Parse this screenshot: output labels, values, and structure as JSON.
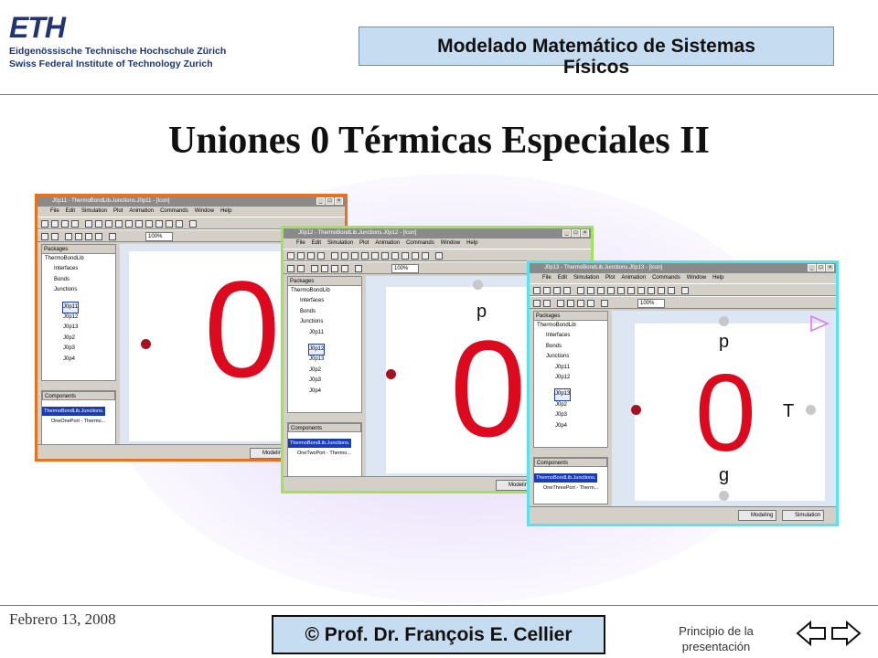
{
  "header": {
    "logo_word": "ETH",
    "logo_line1": "Eidgenössische Technische Hochschule Zürich",
    "logo_line2": "Swiss Federal Institute of Technology Zurich",
    "course_line1": "Modelado Matemático de Sistemas",
    "course_line2": "Físicos"
  },
  "slide_title": "Uniones 0 Térmicas Especiales II",
  "footer": {
    "date": "Febrero 13, 2008",
    "author": "© Prof. Dr. François E. Cellier",
    "home_link_line1": "Principio de la",
    "home_link_line2": "presentación"
  },
  "windows": [
    {
      "title": "J0p11 - ThermoBondLib.Junctions.J0p11 - [Icon]",
      "border_color": "#e8701e",
      "menu": [
        "File",
        "Edit",
        "Simulation",
        "Plot",
        "Animation",
        "Commands",
        "Window",
        "Help"
      ],
      "zoom": "100%",
      "packages_label": "Packages",
      "tree": [
        "ThermoBondLib",
        "Interfaces",
        "Bonds",
        "Junctions",
        "J0p11",
        "J0p12",
        "J0p13",
        "J0p2",
        "J0p3",
        "J0p4"
      ],
      "selected_tree_item": "J0p11",
      "components_label": "Components",
      "component_path": "ThermoBondLib.Junctions.",
      "component_port": "OneOnePort - Thermo...",
      "mode_button": "Modeling",
      "symbol": "0",
      "port_labels": []
    },
    {
      "title": "J0p12 - ThermoBondLib.Junctions.J0p12 - [Icon]",
      "border_color": "#9ee35a",
      "menu": [
        "File",
        "Edit",
        "Simulation",
        "Plot",
        "Animation",
        "Commands",
        "Window",
        "Help"
      ],
      "zoom": "100%",
      "packages_label": "Packages",
      "tree": [
        "ThermoBondLib",
        "Interfaces",
        "Bonds",
        "Junctions",
        "J0p11",
        "J0p12",
        "J0p13",
        "J0p2",
        "J0p3",
        "J0p4"
      ],
      "selected_tree_item": "J0p12",
      "components_label": "Components",
      "component_path": "ThermoBondLib.Junctions.",
      "component_port": "OneTwoPort - Thermo...",
      "mode_button": "Modeling",
      "symbol": "0",
      "port_labels": [
        "p"
      ]
    },
    {
      "title": "J0p13 - ThermoBondLib.Junctions.J0p13 - [Icon]",
      "border_color": "#55e3f0",
      "menu": [
        "File",
        "Edit",
        "Simulation",
        "Plot",
        "Animation",
        "Commands",
        "Window",
        "Help"
      ],
      "zoom": "100%",
      "packages_label": "Packages",
      "tree": [
        "ThermoBondLib",
        "Interfaces",
        "Bonds",
        "Junctions",
        "J0p11",
        "J0p12",
        "J0p13",
        "J0p2",
        "J0p3",
        "J0p4"
      ],
      "selected_tree_item": "J0p13",
      "components_label": "Components",
      "component_path": "ThermoBondLib.Junctions.",
      "component_port": "OneThreePort - Therm...",
      "mode_button": "Modeling",
      "mode_button_2": "Simulation",
      "symbol": "0",
      "port_labels": [
        "p",
        "T",
        "g"
      ]
    }
  ],
  "colors": {
    "accent_box": "#c6dcf0",
    "zero_red": "#dd0a1f",
    "eth_blue": "#1f3470"
  }
}
